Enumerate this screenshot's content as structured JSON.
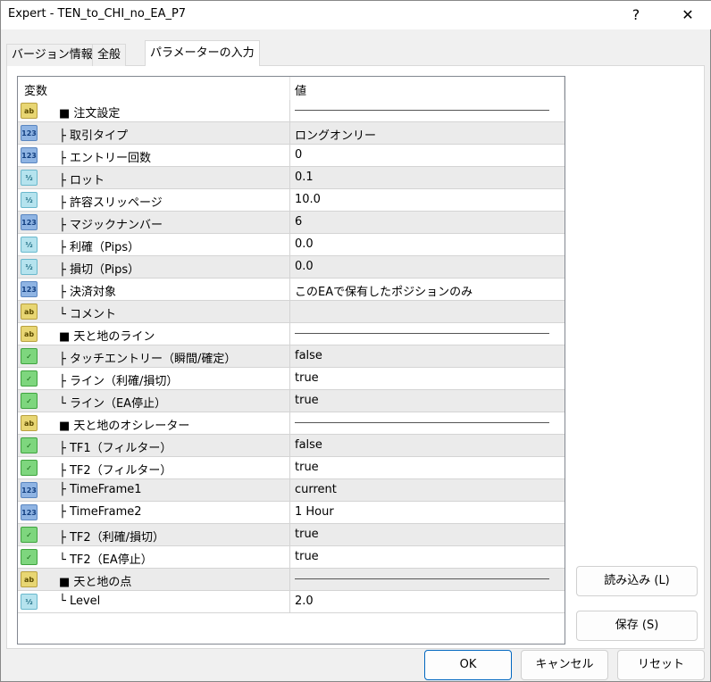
{
  "window": {
    "title": "Expert - TEN_to_CHI_no_EA_P7",
    "help": "?",
    "close": "✕"
  },
  "tabs": [
    {
      "label": "バージョン情報"
    },
    {
      "label": "全般"
    },
    {
      "label": "パラメーターの入力"
    }
  ],
  "table": {
    "headers": {
      "name": "変数",
      "value": "値"
    },
    "rows": [
      {
        "type": "ab",
        "icon": "ab",
        "name": "■ 注文設定",
        "value": "",
        "separator": true
      },
      {
        "type": "int",
        "icon": "123",
        "name": "├ 取引タイプ",
        "value": "ロングオンリー"
      },
      {
        "type": "int",
        "icon": "123",
        "name": "├ エントリー回数",
        "value": "0"
      },
      {
        "type": "dbl",
        "icon": "½",
        "name": "├ ロット",
        "value": "0.1"
      },
      {
        "type": "dbl",
        "icon": "½",
        "name": "├ 許容スリッページ",
        "value": "10.0"
      },
      {
        "type": "int",
        "icon": "123",
        "name": "├ マジックナンバー",
        "value": "6"
      },
      {
        "type": "dbl",
        "icon": "½",
        "name": "├ 利確（Pips）",
        "value": "0.0"
      },
      {
        "type": "dbl",
        "icon": "½",
        "name": "├ 損切（Pips）",
        "value": "0.0"
      },
      {
        "type": "int",
        "icon": "123",
        "name": "├ 決済対象",
        "value": "このEAで保有したポジションのみ"
      },
      {
        "type": "ab",
        "icon": "ab",
        "name": "└ コメント",
        "value": ""
      },
      {
        "type": "ab",
        "icon": "ab",
        "name": "■ 天と地のライン",
        "value": "",
        "separator": true
      },
      {
        "type": "bool",
        "icon": "✓",
        "name": "├ タッチエントリー（瞬間/確定）",
        "value": "false"
      },
      {
        "type": "bool",
        "icon": "✓",
        "name": "├ ライン（利確/損切）",
        "value": "true"
      },
      {
        "type": "bool",
        "icon": "✓",
        "name": "└ ライン（EA停止）",
        "value": "true"
      },
      {
        "type": "ab",
        "icon": "ab",
        "name": "■ 天と地のオシレーター",
        "value": "",
        "separator": true
      },
      {
        "type": "bool",
        "icon": "✓",
        "name": "├ TF1（フィルター）",
        "value": "false"
      },
      {
        "type": "bool",
        "icon": "✓",
        "name": "├ TF2（フィルター）",
        "value": "true"
      },
      {
        "type": "int",
        "icon": "123",
        "name": "├ TimeFrame1",
        "value": "current"
      },
      {
        "type": "int",
        "icon": "123",
        "name": "├ TimeFrame2",
        "value": "1 Hour"
      },
      {
        "type": "bool",
        "icon": "✓",
        "name": "├ TF2（利確/損切）",
        "value": "true"
      },
      {
        "type": "bool",
        "icon": "✓",
        "name": "└ TF2（EA停止）",
        "value": "true"
      },
      {
        "type": "ab",
        "icon": "ab",
        "name": "■ 天と地の点",
        "value": "",
        "separator": true
      },
      {
        "type": "dbl",
        "icon": "½",
        "name": "└ Level",
        "value": "2.0"
      }
    ]
  },
  "buttons": {
    "load": "読み込み (L)",
    "save": "保存 (S)",
    "ok": "OK",
    "cancel": "キャンセル",
    "reset": "リセット"
  }
}
